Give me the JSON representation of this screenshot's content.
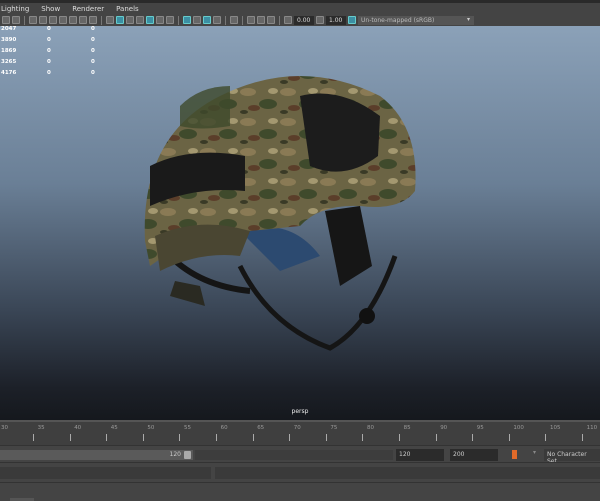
{
  "menu": [
    "Lighting",
    "Show",
    "Renderer",
    "Panels"
  ],
  "toolbar": {
    "exposure": "0.00",
    "gamma": "1.00",
    "color_management": "Un-tone-mapped (sRGB)"
  },
  "hud": [
    [
      "2047",
      "0",
      "0"
    ],
    [
      "3890",
      "0",
      "0"
    ],
    [
      "1869",
      "0",
      "0"
    ],
    [
      "3265",
      "0",
      "0"
    ],
    [
      "4176",
      "0",
      "0"
    ]
  ],
  "camera": "persp",
  "ruler": {
    "labels": [
      "30",
      "35",
      "40",
      "45",
      "50",
      "55",
      "60",
      "65",
      "70",
      "75",
      "80",
      "85",
      "90",
      "95",
      "100",
      "105",
      "110"
    ]
  },
  "range": {
    "slider_end": "120",
    "end_time": "120",
    "playback_end": "200",
    "character_set": "No Character Set"
  }
}
